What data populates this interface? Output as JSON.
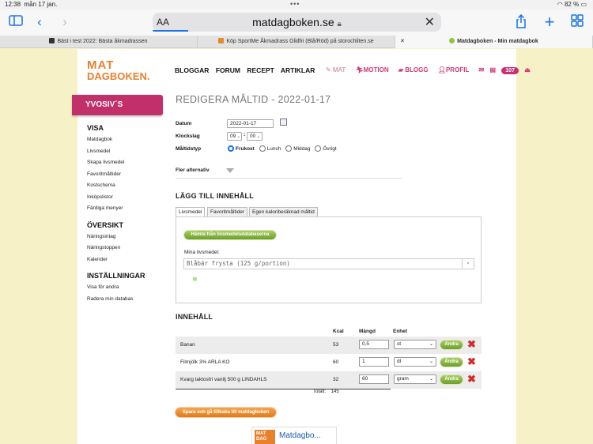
{
  "status": {
    "time": "12:38",
    "date": "mån 17 jan.",
    "battery": "82 %"
  },
  "browser": {
    "aa": "AA",
    "url": "matdagboken.se",
    "tabs": [
      {
        "label": "Bäst i test 2022: Bästa åkmadrassen",
        "favicon_color": "#333333"
      },
      {
        "label": "Köp SportMe Åkmadrass Glidfri (Blå/Röd) på storochliten.se",
        "favicon_color": "#e58a2b"
      },
      {
        "label": "Matdagboken - Min matdagbok",
        "favicon_color": "#8cc63f"
      }
    ]
  },
  "logo": {
    "line1": "MAT",
    "line2": "DAGBOKEN."
  },
  "topnav": [
    "BLOGGAR",
    "FORUM",
    "RECEPT",
    "ARTIKLAR"
  ],
  "rightnav": {
    "mat": "MAT",
    "motion": "MOTION",
    "blogg": "BLOGG",
    "profil": "PROFIL",
    "badge": "107"
  },
  "user": "YVOSIV´S",
  "sidebar": {
    "visa_title": "VISA",
    "visa": [
      "Matdagbok",
      "Livsmedel",
      "Skapa livsmedel",
      "Favoritmåltider",
      "Kostschema",
      "Inköpslistor",
      "Färdiga menyer"
    ],
    "oversikt_title": "ÖVERSIKT",
    "oversikt": [
      "Näringsintag",
      "Näringstoppen",
      "Kalender"
    ],
    "installningar_title": "INSTÄLLNINGAR",
    "installningar": [
      "Visa för andra",
      "Radera min databas"
    ]
  },
  "form": {
    "title": "REDIGERA MÅLTID - 2022-01-17",
    "datum_label": "Datum",
    "datum_value": "2022-01-17",
    "klockslag_label": "Klockslag",
    "hour": "09",
    "minute": "00",
    "maltidstyp_label": "Måltidstyp",
    "types": [
      "Frukost",
      "Lunch",
      "Middag",
      "Övrigt"
    ],
    "selected_type": "Frukost",
    "fler": "Fler alternativ"
  },
  "add": {
    "title": "LÄGG TILL INNEHÅLL",
    "tabs": [
      "Livsmedel",
      "Favoritmåltider",
      "Egen kaloriberäknad måltid"
    ],
    "fetch_button": "Hämta från livsmedelsdatabaserna",
    "mina_label": "Mina livsmedel:",
    "selected_food": "Blåbär frysta (125 g/portion)"
  },
  "content": {
    "title": "INNEHÅLL",
    "headers": {
      "kcal": "Kcal",
      "mangd": "Mängd",
      "enhet": "Enhet"
    },
    "rows": [
      {
        "name": "Banan",
        "kcal": "53",
        "qty": "0,5",
        "unit": "st",
        "button": "Ändra"
      },
      {
        "name": "Filmjölk 3% ARLA KO",
        "kcal": "60",
        "qty": "1",
        "unit": "dl",
        "button": "Ändra"
      },
      {
        "name": "Kvarg laktosfri vanilj 500 g LINDAHLS",
        "kcal": "32",
        "qty": "60",
        "unit": "gram",
        "button": "Ändra"
      }
    ],
    "total_label": "Totalt:",
    "total_value": "145"
  },
  "save_button": "Spara och gå tillbaka till matdagboken",
  "promo": {
    "logo": "MAT DAG",
    "text": "Matdagbo..."
  }
}
